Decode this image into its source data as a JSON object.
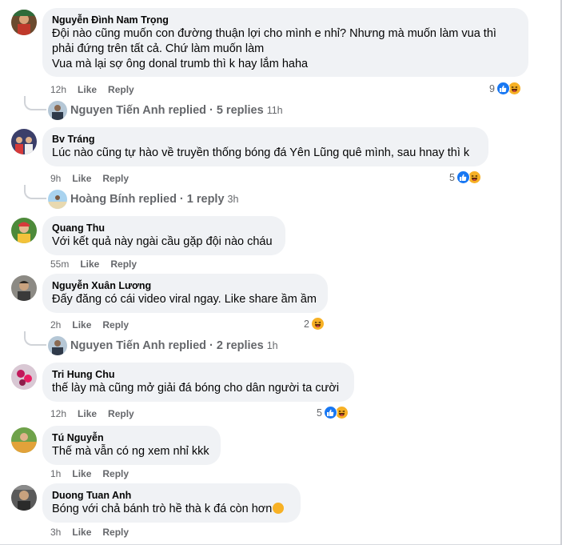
{
  "comments": [
    {
      "author": "Nguyễn Đình Nam Trọng",
      "lines": [
        "Đội nào cũng muốn con đường thuận lợi cho mình e nhỉ? Nhưng mà muốn làm vua thì",
        "phải đứng trên tất cả. Chứ làm muốn làm",
        "Vua mà lại sợ ông donal trumb thì k hay lắm haha"
      ],
      "time": "12h",
      "like": "Like",
      "reply": "Reply",
      "reaction_count": "9",
      "reactions": [
        "like-icon",
        "haha-icon"
      ],
      "replies": {
        "name": "Nguyen Tiến Anh replied",
        "count": "5 replies",
        "time": "11h"
      }
    },
    {
      "author": "Bv Tráng",
      "lines": [
        "Lúc nào cũng tự hào về truyền thống bóng đá Yên Lũng quê mình, sau hnay thì k"
      ],
      "time": "9h",
      "like": "Like",
      "reply": "Reply",
      "reaction_count": "5",
      "reactions": [
        "like-icon",
        "haha-icon"
      ],
      "replies": {
        "name": "Hoàng Bính replied",
        "count": "1 reply",
        "time": "3h"
      }
    },
    {
      "author": "Quang Thu",
      "lines": [
        "Với kết quả này ngài cầu gặp đội nào cháu"
      ],
      "time": "55m",
      "like": "Like",
      "reply": "Reply"
    },
    {
      "author": "Nguyễn Xuân Lương",
      "lines": [
        "Đấy đăng có cái video viral ngay. Like share ầm ầm"
      ],
      "time": "2h",
      "like": "Like",
      "reply": "Reply",
      "reaction_count": "2",
      "reactions": [
        "haha-icon"
      ],
      "replies": {
        "name": "Nguyen Tiến Anh replied",
        "count": "2 replies",
        "time": "1h"
      }
    },
    {
      "author": "Tri Hung Chu",
      "lines": [
        "thế lày mà cũng mở giải đá bóng cho dân người ta cười"
      ],
      "time": "12h",
      "like": "Like",
      "reply": "Reply",
      "reaction_count": "5",
      "reactions": [
        "like-icon",
        "haha-icon"
      ]
    },
    {
      "author": "Tú Nguyễn",
      "lines": [
        "Thế mà vẫn có ng xem nhỉ kkk"
      ],
      "time": "1h",
      "like": "Like",
      "reply": "Reply"
    },
    {
      "author": "Duong Tuan Anh",
      "lines": [
        "Bóng với chả bánh trò hề thà k đá còn hơn"
      ],
      "time": "3h",
      "like": "Like",
      "reply": "Reply",
      "inline_emoji": "rolling-laughing-emoji"
    }
  ],
  "colors": {
    "bubble": "#f0f2f5",
    "like_blue": "#1877f2",
    "haha_yellow": "#f7b125",
    "meta_gray": "#65676b"
  }
}
